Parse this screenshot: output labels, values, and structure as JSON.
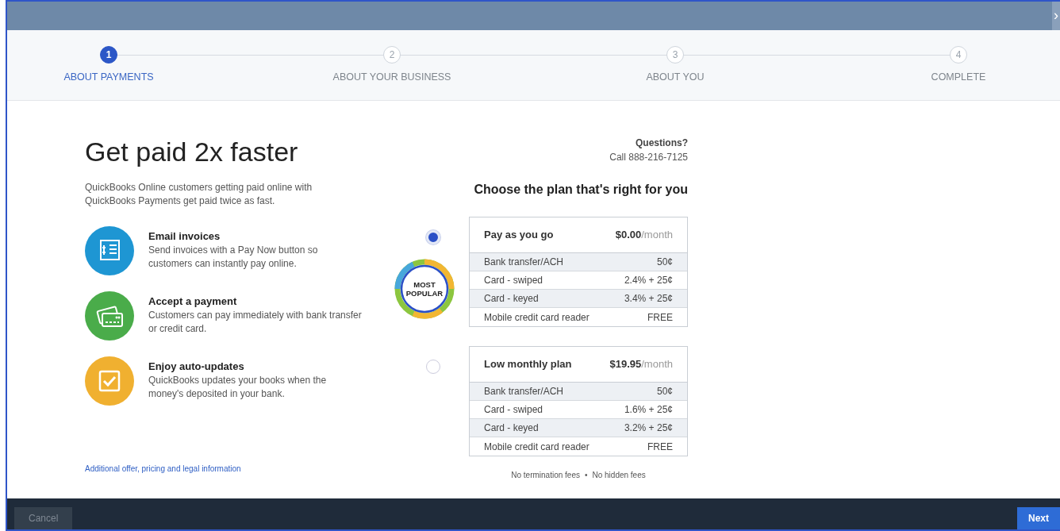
{
  "top_bar": {
    "collapse_glyph": "›"
  },
  "steps": [
    {
      "number": "1",
      "label": "ABOUT PAYMENTS",
      "selected": true
    },
    {
      "number": "2",
      "label": "ABOUT YOUR BUSINESS",
      "selected": false
    },
    {
      "number": "3",
      "label": "ABOUT YOU",
      "selected": false
    },
    {
      "number": "4",
      "label": "COMPLETE",
      "selected": false
    }
  ],
  "heading": "Get paid 2x faster",
  "intro": "QuickBooks Online customers getting paid online with QuickBooks Payments get paid twice as fast.",
  "features": [
    {
      "kind": "invoice",
      "title": "Email invoices",
      "text": "Send invoices with a Pay Now button so customers can instantly pay online."
    },
    {
      "kind": "payment",
      "title": "Accept a payment",
      "text": "Customers can pay immediately with bank transfer or credit card."
    },
    {
      "kind": "updates",
      "title": "Enjoy auto-updates",
      "text": "QuickBooks updates your books when the money's deposited in your bank."
    }
  ],
  "legal_link": "Additional offer, pricing and legal information",
  "questions": {
    "title": "Questions?",
    "phone": "Call 888-216-7125"
  },
  "plans_title": "Choose the plan that's right for you",
  "plans": [
    {
      "name": "Pay as you go",
      "price": "$0.00",
      "period": "/month",
      "selected": true,
      "badge": [
        "MOST",
        "POPULAR"
      ],
      "fees": [
        {
          "label": "Bank transfer/ACH",
          "value": "50¢"
        },
        {
          "label": "Card - swiped",
          "value": "2.4% + 25¢"
        },
        {
          "label": "Card - keyed",
          "value": "3.4% + 25¢"
        },
        {
          "label": "Mobile credit card reader",
          "value": "FREE"
        }
      ]
    },
    {
      "name": "Low monthly plan",
      "price": "$19.95",
      "period": "/month",
      "selected": false,
      "fees": [
        {
          "label": "Bank transfer/ACH",
          "value": "50¢"
        },
        {
          "label": "Card - swiped",
          "value": "1.6% + 25¢"
        },
        {
          "label": "Card - keyed",
          "value": "3.2% + 25¢"
        },
        {
          "label": "Mobile credit card reader",
          "value": "FREE"
        }
      ]
    }
  ],
  "fee_notes": [
    "No termination fees",
    "•",
    "No hidden fees"
  ],
  "footer": {
    "cancel": "Cancel",
    "next": "Next"
  }
}
